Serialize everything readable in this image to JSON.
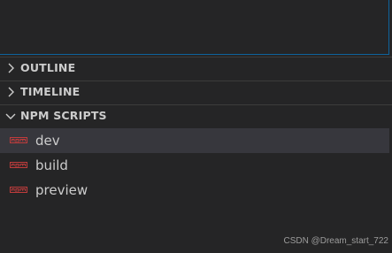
{
  "sections": {
    "outline": {
      "label": "OUTLINE",
      "expanded": false
    },
    "timeline": {
      "label": "TIMELINE",
      "expanded": false
    },
    "npm_scripts": {
      "label": "NPM SCRIPTS",
      "expanded": true,
      "scripts": [
        {
          "label": "dev",
          "icon": "npm-icon",
          "selected": true
        },
        {
          "label": "build",
          "icon": "npm-icon",
          "selected": false
        },
        {
          "label": "preview",
          "icon": "npm-icon",
          "selected": false
        }
      ]
    }
  },
  "watermark": "CSDN @Dream_start_722",
  "colors": {
    "background": "#252526",
    "selection": "#37373d",
    "focus_border": "#0e639c",
    "npm_red": "#c13c3c",
    "text": "#cccccc"
  }
}
